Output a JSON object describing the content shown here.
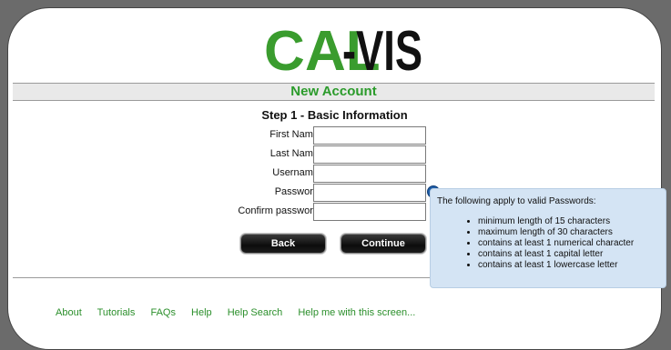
{
  "logo": {
    "text_part1": "C",
    "text_part2": "AL",
    "text_part3": "-VIS",
    "colors": {
      "green": "#3a9c2e",
      "black": "#111111"
    }
  },
  "page_title": "New Account",
  "step_title": "Step 1 - Basic Information",
  "form": {
    "first_name_label": "First Name",
    "last_name_label": "Last Name",
    "username_label": "Username",
    "password_label": "Password",
    "confirm_password_label": "Confirm password",
    "first_name_value": "",
    "last_name_value": "",
    "username_value": "",
    "password_value": "",
    "confirm_password_value": ""
  },
  "help_icon": {
    "glyph": "?"
  },
  "buttons": {
    "back": "Back",
    "continue": "Continue"
  },
  "tooltip": {
    "intro": "The following apply to valid Passwords:",
    "items": [
      "minimum length of 15 characters",
      "maximum length of 30 characters",
      "contains at least 1 numerical character",
      "contains at least 1 capital letter",
      "contains at least 1 lowercase letter"
    ]
  },
  "footer": {
    "links": [
      "About",
      "Tutorials",
      "FAQs",
      "Help",
      "Help Search",
      "Help me with this screen..."
    ]
  },
  "colors": {
    "accent_green": "#2b9b2b",
    "background": "#6b6b6b",
    "tooltip_bg": "#d4e4f4"
  }
}
